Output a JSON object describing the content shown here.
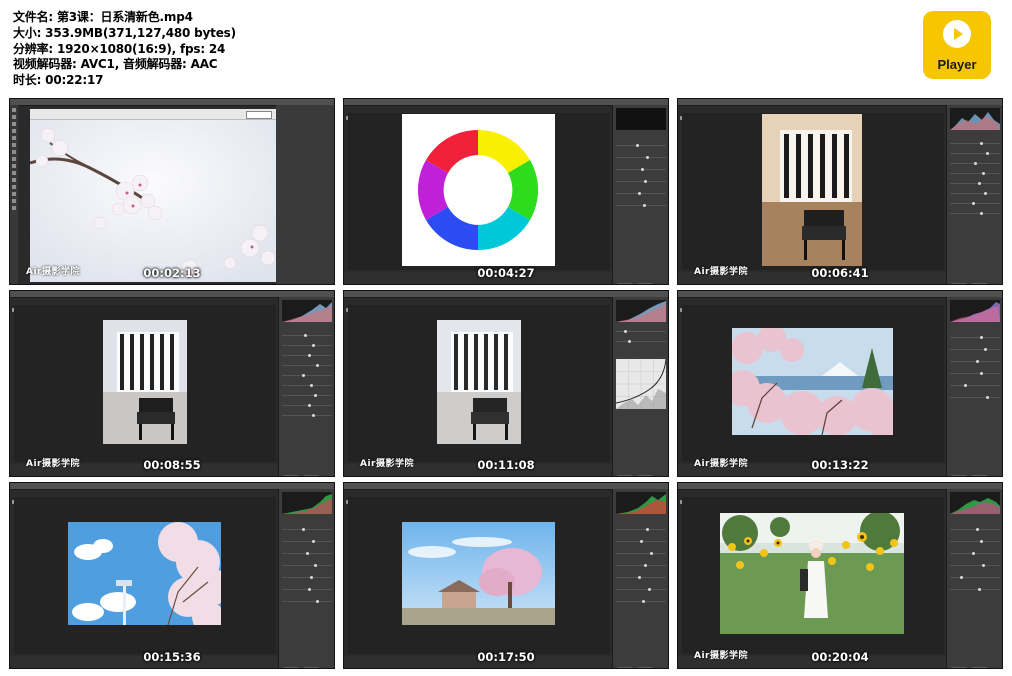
{
  "file_info": {
    "filename": "文件名: 第3课：日系清新色.mp4",
    "size": "大小: 353.9MB(371,127,480 bytes)",
    "resolution": "分辨率: 1920×1080(16:9), fps: 24",
    "codecs": "视频解码器: AVC1, 音频解码器: AAC",
    "duration": "时长: 00:22:17"
  },
  "player_logo": {
    "label": "Player",
    "icon": "play-icon",
    "color": "#f7c600"
  },
  "thumbnails": [
    {
      "timestamp": "00:02:13",
      "watermark": "Air摄影学院",
      "content": "photoshop-cherry-blossom"
    },
    {
      "timestamp": "00:04:27",
      "watermark": "",
      "content": "color-wheel"
    },
    {
      "timestamp": "00:06:41",
      "watermark": "Air摄影学院",
      "content": "window-interior-warm"
    },
    {
      "timestamp": "00:08:55",
      "watermark": "Air摄影学院",
      "content": "window-interior-cool"
    },
    {
      "timestamp": "00:11:08",
      "watermark": "Air摄影学院",
      "content": "window-interior-curves"
    },
    {
      "timestamp": "00:13:22",
      "watermark": "Air摄影学院",
      "content": "cherry-blossom-mountain"
    },
    {
      "timestamp": "00:15:36",
      "watermark": "",
      "content": "cherry-blossom-sky"
    },
    {
      "timestamp": "00:17:50",
      "watermark": "",
      "content": "cherry-tree-landscape"
    },
    {
      "timestamp": "00:20:04",
      "watermark": "Air摄影学院",
      "content": "sunflower-girl"
    }
  ]
}
